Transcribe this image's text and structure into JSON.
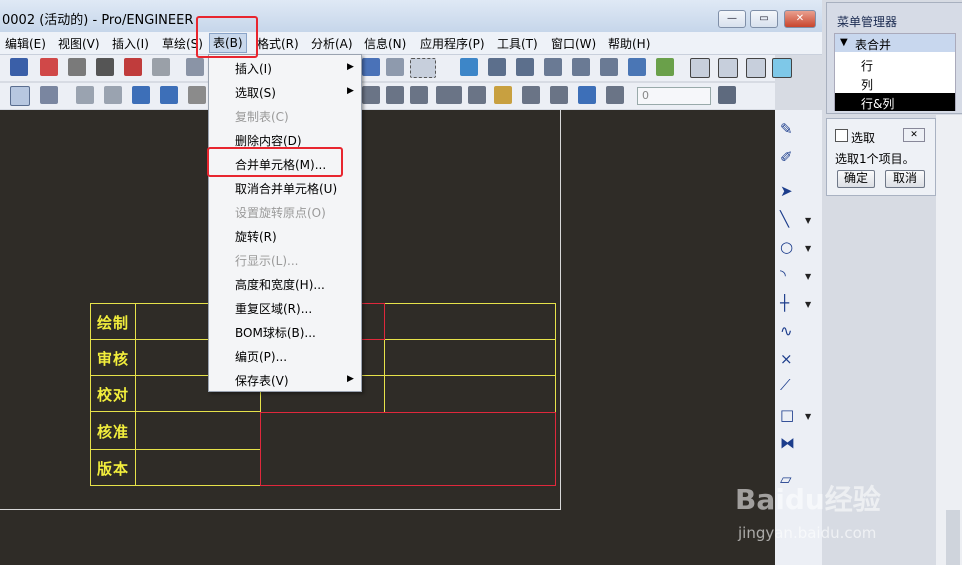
{
  "window": {
    "title": "0002 (活动的) - Pro/ENGINEER",
    "buttons": {
      "minimize": "—",
      "maximize": "▭",
      "close": "✕"
    }
  },
  "menubar": {
    "items": [
      "编辑(E)",
      "视图(V)",
      "插入(I)",
      "草绘(S)",
      "表(B)",
      "格式(R)",
      "分析(A)",
      "信息(N)",
      "应用程序(P)",
      "工具(T)",
      "窗口(W)",
      "帮助(H)"
    ]
  },
  "toolbar": {
    "number_field": "0"
  },
  "table_menu": {
    "items": [
      {
        "label": "插入(I)",
        "submenu": true,
        "enabled": true
      },
      {
        "label": "选取(S)",
        "submenu": true,
        "enabled": true
      },
      {
        "label": "复制表(C)",
        "submenu": false,
        "enabled": false
      },
      {
        "label": "删除内容(D)",
        "submenu": false,
        "enabled": true
      },
      {
        "label": "合并单元格(M)...",
        "submenu": false,
        "enabled": true
      },
      {
        "label": "取消合并单元格(U)",
        "submenu": false,
        "enabled": true
      },
      {
        "label": "设置旋转原点(O)",
        "submenu": false,
        "enabled": false
      },
      {
        "label": "旋转(R)",
        "submenu": false,
        "enabled": true
      },
      {
        "label": "行显示(L)...",
        "submenu": false,
        "enabled": false
      },
      {
        "label": "高度和宽度(H)...",
        "submenu": false,
        "enabled": true
      },
      {
        "label": "重复区域(R)...",
        "submenu": false,
        "enabled": true
      },
      {
        "label": "BOM球标(B)...",
        "submenu": false,
        "enabled": true
      },
      {
        "label": "编页(P)...",
        "submenu": false,
        "enabled": true
      },
      {
        "label": "保存表(V)",
        "submenu": true,
        "enabled": true
      }
    ]
  },
  "drawing_table": {
    "row_labels": [
      "绘制",
      "审核",
      "校对",
      "核准",
      "版本"
    ]
  },
  "menu_manager": {
    "title": "菜单管理器",
    "section": "表合并",
    "options": [
      "行",
      "列",
      "行&列"
    ],
    "selected": "行&列"
  },
  "select_dialog": {
    "title": "选取",
    "message": "选取1个项目。",
    "ok": "确定",
    "cancel": "取消"
  },
  "watermark": {
    "brand": "Baidu经验",
    "url": "jingyan.baidu.com"
  },
  "colors": {
    "highlight_red": "#e8262f",
    "table_yellow": "#e6e24a",
    "merge_red": "#e0283c",
    "canvas": "#2f2c27"
  }
}
